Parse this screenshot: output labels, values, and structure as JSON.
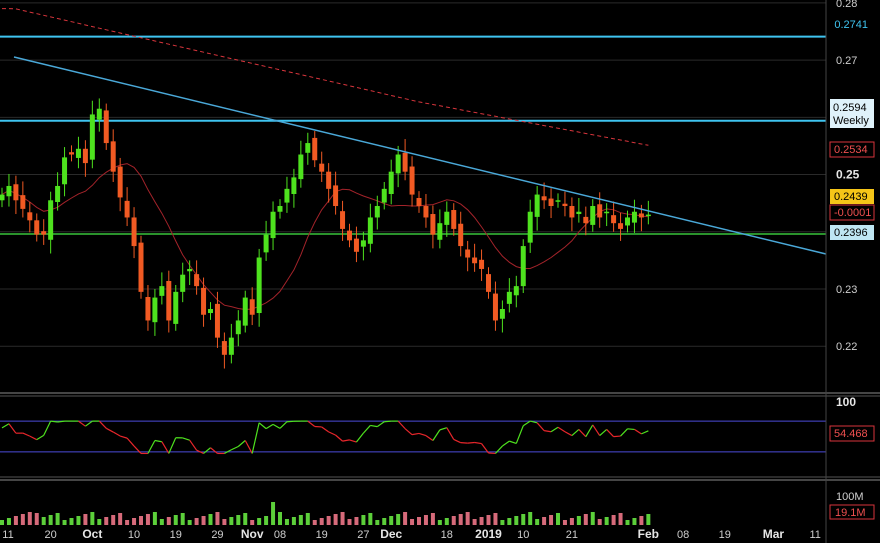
{
  "colors": {
    "background": "#000000",
    "up": "#4ee21e",
    "down": "#f15a23",
    "grid": "#2a2a2a",
    "axis_text": "#cfcfcf",
    "hline": "#3fc4f0",
    "trend": "#4aa8d8",
    "support": "#39c43a",
    "ma": "#d8353c",
    "rsi_up": "#4ee21e",
    "rsi_down": "#e8262b",
    "rsi_band": "#4b4bd8"
  },
  "chart_data": {
    "type": "candlestick",
    "ylim": [
      0.212,
      0.2805
    ],
    "y_ticks": [
      {
        "v": 0.28,
        "label": "0.28",
        "bold": false
      },
      {
        "v": 0.27,
        "label": "0.27",
        "bold": false
      },
      {
        "v": 0.25,
        "label": "0.25",
        "bold": true
      },
      {
        "v": 0.23,
        "label": "0.23",
        "bold": false
      },
      {
        "v": 0.22,
        "label": "0.22",
        "bold": false
      }
    ],
    "x_ticks": [
      {
        "i": 0,
        "label": "11",
        "bold": false
      },
      {
        "i": 7,
        "label": "20",
        "bold": false
      },
      {
        "i": 13,
        "label": "Oct",
        "bold": true
      },
      {
        "i": 19,
        "label": "10",
        "bold": false
      },
      {
        "i": 25,
        "label": "19",
        "bold": false
      },
      {
        "i": 31,
        "label": "29",
        "bold": false
      },
      {
        "i": 36,
        "label": "Nov",
        "bold": true
      },
      {
        "i": 40,
        "label": "08",
        "bold": false
      },
      {
        "i": 46,
        "label": "19",
        "bold": false
      },
      {
        "i": 52,
        "label": "27",
        "bold": false
      },
      {
        "i": 56,
        "label": "Dec",
        "bold": true
      },
      {
        "i": 64,
        "label": "18",
        "bold": false
      },
      {
        "i": 70,
        "label": "2019",
        "bold": true
      },
      {
        "i": 75,
        "label": "10",
        "bold": false
      },
      {
        "i": 82,
        "label": "21",
        "bold": false
      },
      {
        "i": 93,
        "label": "Feb",
        "bold": true
      },
      {
        "i": 98,
        "label": "08",
        "bold": false
      },
      {
        "i": 104,
        "label": "19",
        "bold": false
      },
      {
        "i": 111,
        "label": "Mar",
        "bold": true
      },
      {
        "i": 117,
        "label": "11",
        "bold": false
      }
    ],
    "closes": [
      0.2465,
      0.248,
      0.2455,
      0.244,
      0.242,
      0.2395,
      0.2395,
      0.2455,
      0.248,
      0.253,
      0.2535,
      0.2545,
      0.252,
      0.2605,
      0.2615,
      0.2555,
      0.2505,
      0.246,
      0.2425,
      0.2375,
      0.2295,
      0.2245,
      0.2285,
      0.2305,
      0.2245,
      0.2295,
      0.2325,
      0.2335,
      0.2305,
      0.2255,
      0.2265,
      0.2215,
      0.2185,
      0.2215,
      0.2245,
      0.2285,
      0.2255,
      0.2355,
      0.2395,
      0.2435,
      0.2445,
      0.2475,
      0.2495,
      0.2535,
      0.2555,
      0.2525,
      0.2505,
      0.2475,
      0.2445,
      0.2405,
      0.2385,
      0.2365,
      0.2385,
      0.2425,
      0.2445,
      0.2475,
      0.2505,
      0.2535,
      0.2505,
      0.2465,
      0.2445,
      0.2425,
      0.2395,
      0.2415,
      0.2435,
      0.2405,
      0.2375,
      0.2355,
      0.2345,
      0.2335,
      0.2295,
      0.2245,
      0.2265,
      0.2295,
      0.2305,
      0.2375,
      0.2435,
      0.2465,
      0.2455,
      0.2445,
      0.2455,
      0.2445,
      0.2425,
      0.2435,
      0.2415,
      0.2445,
      0.2425,
      0.2435,
      0.2415,
      0.2405,
      0.2425,
      0.2435,
      0.2425,
      0.243
    ],
    "y_series": {
      "resistance_1": 0.2741,
      "resistance_2_weekly": 0.2594,
      "support": 0.2396
    },
    "last_price": 0.2439,
    "change": -0.0001,
    "ma_last": 0.2534,
    "rsi_ylim": [
      0,
      100
    ],
    "rsi_band": [
      30,
      70
    ],
    "rsi_last": 54.468,
    "volume_last": "19.1M",
    "volume_tick": "100M"
  },
  "labels": {
    "resistance_1": "0.2741",
    "weekly_price": "0.2594",
    "weekly_text": "Weekly",
    "ma_value": "0.2534",
    "last_price": "0.2439",
    "change": "-0.0001",
    "support": "0.2396",
    "rsi_top": "100",
    "rsi_value": "54.468",
    "vol_top": "100M",
    "vol_value": "19.1M"
  }
}
